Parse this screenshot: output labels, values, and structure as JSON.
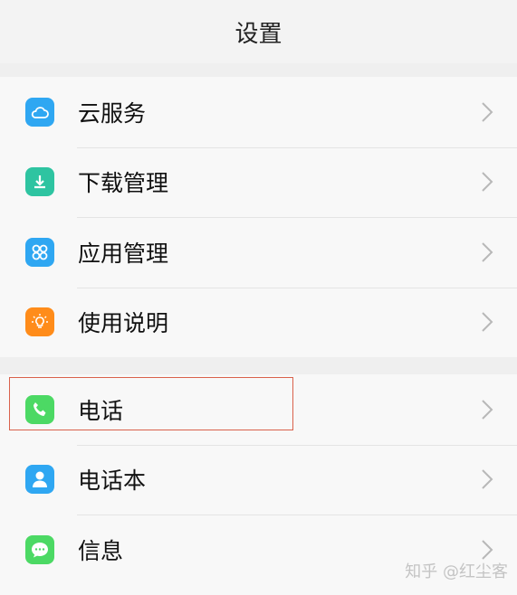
{
  "header": {
    "title": "设置"
  },
  "group1": [
    {
      "label": "云服务",
      "icon": "cloud-icon",
      "color": "#2fa7f2"
    },
    {
      "label": "下载管理",
      "icon": "download-icon",
      "color": "#2ec4a1"
    },
    {
      "label": "应用管理",
      "icon": "apps-icon",
      "color": "#2fa7f2"
    },
    {
      "label": "使用说明",
      "icon": "lightbulb-icon",
      "color": "#ff8c1a"
    }
  ],
  "group2": [
    {
      "label": "电话",
      "icon": "phone-icon",
      "color": "#4cd964"
    },
    {
      "label": "电话本",
      "icon": "contacts-icon",
      "color": "#2fa7f2"
    },
    {
      "label": "信息",
      "icon": "message-icon",
      "color": "#4cd964"
    }
  ],
  "watermark": "知乎 @红尘客"
}
